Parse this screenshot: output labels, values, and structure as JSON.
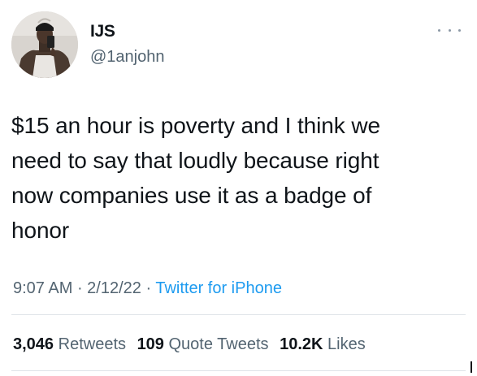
{
  "user": {
    "display_name": "IJS",
    "handle": "@1anjohn"
  },
  "more_icon": "more-horizontal-icon",
  "tweet": {
    "lines": [
      "$15 an hour is poverty and I think we",
      "need to say that loudly because right",
      "now companies use it as a badge of",
      "honor"
    ]
  },
  "meta": {
    "time": "9:07 AM",
    "sep1": " · ",
    "date": "2/12/22",
    "sep2": " · ",
    "source": "Twitter for iPhone"
  },
  "stats": {
    "retweets_count": "3,046",
    "retweets_label": "Retweets",
    "quotes_count": "109",
    "quotes_label": "Quote Tweets",
    "likes_count": "10.2K",
    "likes_label": "Likes"
  },
  "colors": {
    "text": "#0f1419",
    "secondary": "#536471",
    "link": "#1d9bf0",
    "divider": "#dfe4e8"
  }
}
